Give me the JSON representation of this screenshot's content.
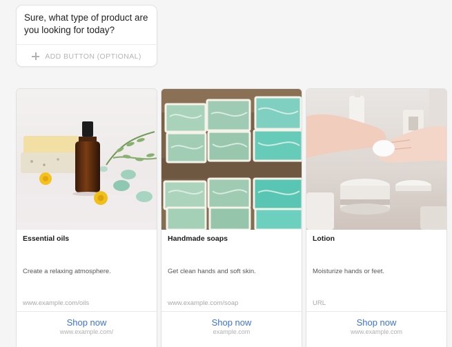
{
  "bubble": {
    "text": "Sure, what type of product are you looking for today?",
    "add_button_label": "ADD BUTTON (OPTIONAL)"
  },
  "cards": [
    {
      "title": "Essential oils",
      "description": "Create a relaxing atmosphere.",
      "url": "www.example.com/oils",
      "action_label": "Shop now",
      "action_url": "www.example.com/",
      "image_icon": "essential-oil-bottle-image"
    },
    {
      "title": "Handmade soaps",
      "description": "Get clean hands and soft skin.",
      "url": "www.example.com/soap",
      "action_label": "Shop now",
      "action_url": "example.com",
      "image_icon": "soap-bars-image"
    },
    {
      "title": "Lotion",
      "description": "Moisturize hands or feet.",
      "url": "URL",
      "action_label": "Shop now",
      "action_url": "www.example.com",
      "image_icon": "lotion-hands-image"
    }
  ],
  "colors": {
    "link_blue": "#3b73d9",
    "placeholder_gray": "#b4b4b4"
  }
}
